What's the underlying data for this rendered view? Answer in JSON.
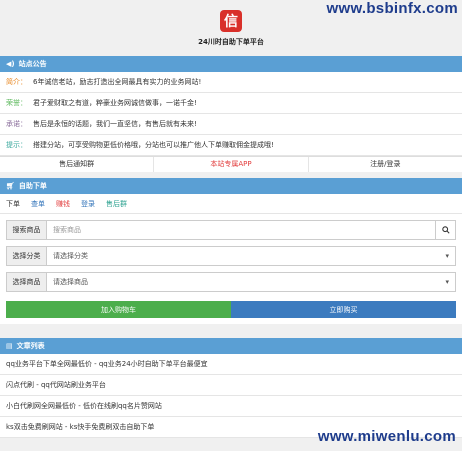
{
  "watermarks": {
    "top": "www.bsbinfx.com",
    "bottom": "www.miwenlu.com"
  },
  "header": {
    "logo_char": "信",
    "title": "24川时自助下单平台"
  },
  "notice": {
    "title": "站点公告",
    "items": [
      {
        "tag": "简介：",
        "text": "6年诚信老站，励志打造出全网最具有实力的业务网站!"
      },
      {
        "tag": "荣誉：",
        "text": "君子爱财取之有道，粹豪业务网诚信做事，一诺千金!"
      },
      {
        "tag": "承诺：",
        "text": "售后是永恒的话题，我们一直坚信，有售后就有未来!"
      },
      {
        "tag": "提示：",
        "text": "搭建分站，可享受购物更低价格哦，分站也可以推广他人下单赚取佣金提成哦!"
      }
    ],
    "links": [
      "售后通知群",
      "本站专属APP",
      "注册/登录"
    ]
  },
  "order": {
    "title": "自助下单",
    "tabs": [
      "下单",
      "查单",
      "赚钱",
      "登录",
      "售后群"
    ],
    "search_label": "搜索商品",
    "search_placeholder": "搜索商品",
    "category_label": "选择分类",
    "category_value": "请选择分类",
    "product_label": "选择商品",
    "product_value": "请选择商品",
    "add_cart": "加入购物车",
    "buy_now": "立即购买"
  },
  "articles": {
    "title": "文章列表",
    "items": [
      "qq业务平台下单全网最低价 - qq业务24小时自助下单平台最便宜",
      "闪点代刷 - qq代网站刷业务平台",
      "小白代刷网全网最低价 - 低价在线刷qq名片赞网站",
      "ks双击免费刷网站 - ks快手免费刷双击自助下单"
    ]
  },
  "colors": {
    "accent": "#5a9fd4",
    "green": "#4cae4c",
    "blue": "#3c7bbf",
    "red": "#e23b3b"
  }
}
